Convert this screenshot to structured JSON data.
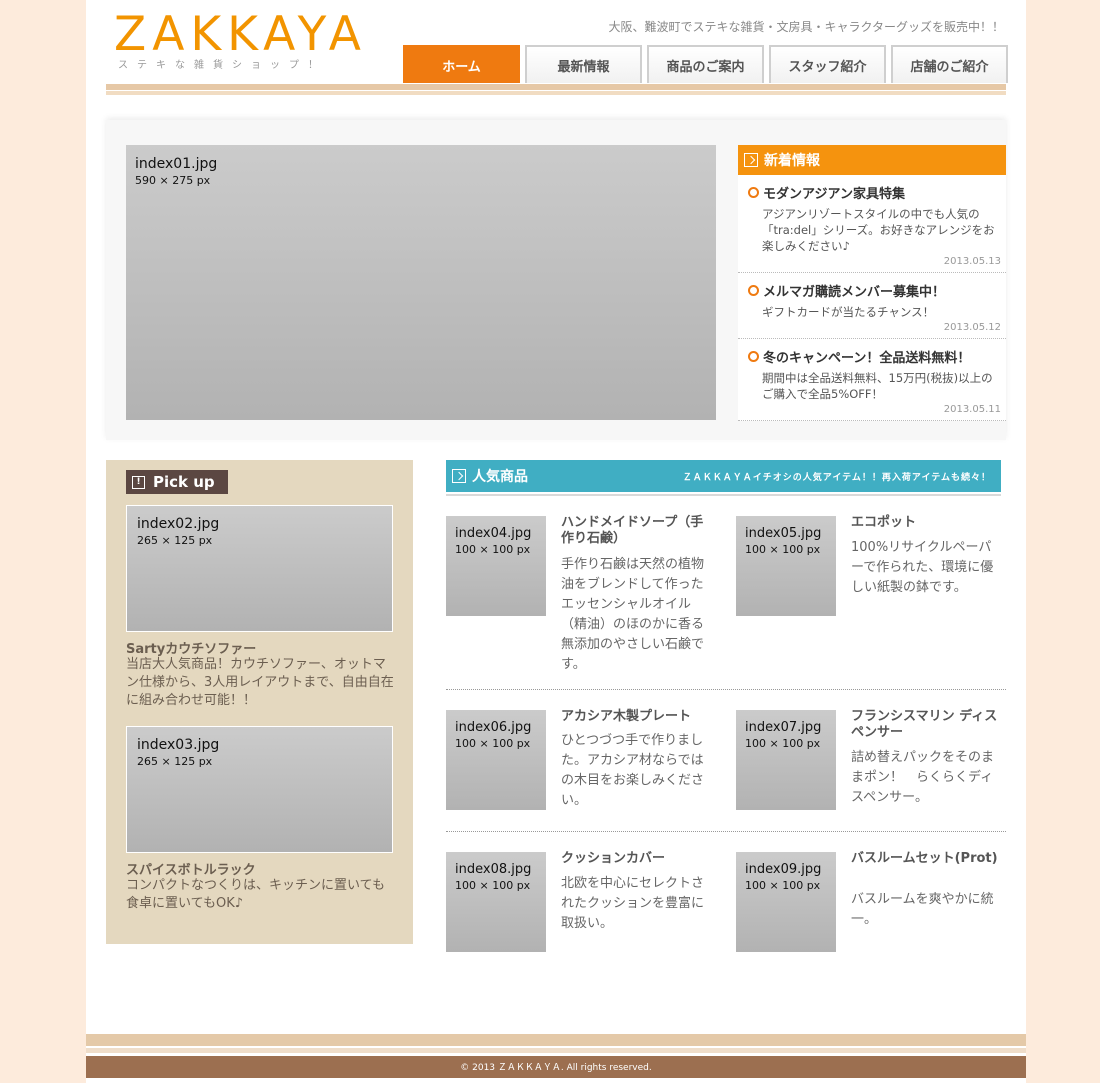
{
  "header": {
    "logo": "ZAKKAYA",
    "logo_sub": "ステキな雑貨ショップ！",
    "tagline": "大阪、難波町でステキな雑貨・文房具・キャラクターグッズを販売中！！",
    "nav": [
      "ホーム",
      "最新情報",
      "商品のご案内",
      "スタッフ紹介",
      "店舗のご紹介"
    ],
    "active_nav": "ホーム"
  },
  "hero": {
    "name": "index01.jpg",
    "size": "590 × 275 px"
  },
  "news": {
    "heading": "新着情報",
    "items": [
      {
        "title": "モダンアジアン家具特集",
        "body": "アジアンリゾートスタイルの中でも人気の「tra:del」シリーズ。お好きなアレンジをお楽しみください♪",
        "date": "2013.05.13"
      },
      {
        "title": "メルマガ購読メンバー募集中！",
        "body": "ギフトカードが当たるチャンス！",
        "date": "2013.05.12"
      },
      {
        "title": "冬のキャンペーン！全品送料無料！",
        "body": "期間中は全品送料無料、15万円(税抜)以上のご購入で全品5%OFF！",
        "date": "2013.05.11"
      }
    ]
  },
  "pickup": {
    "heading": "Pick up",
    "items": [
      {
        "img": "index02.jpg",
        "size": "265 × 125 px",
        "title": "Sartyカウチソファー",
        "desc": "当店大人気商品！カウチソファー、オットマン仕様から、3人用レイアウトまで、自由自在に組み合わせ可能！！"
      },
      {
        "img": "index03.jpg",
        "size": "265 × 125 px",
        "title": "スパイスボトルラック",
        "desc": "コンパクトなつくりは、キッチンに置いても食卓に置いてもOK♪"
      }
    ]
  },
  "popular": {
    "heading": "人気商品",
    "sub": "ＺＡＫＫＡＹＡイチオシの人気アイテム！！再入荷アイテムも続々！",
    "items": [
      {
        "img": "index04.jpg",
        "size": "100 × 100 px",
        "name": "ハンドメイドソープ（手作り石鹸）",
        "desc": "手作り石鹸は天然の植物油をブレンドして作ったエッセンシャルオイル（精油）のほのかに香る無添加のやさしい石鹸です。"
      },
      {
        "img": "index05.jpg",
        "size": "100 × 100 px",
        "name": "エコポット",
        "desc": "100%リサイクルペーパーで作られた、環境に優しい紙製の鉢です。"
      },
      {
        "img": "index06.jpg",
        "size": "100 × 100 px",
        "name": "アカシア木製プレート",
        "desc": "ひとつづつ手で作りました。アカシア材ならではの木目をお楽しみください。"
      },
      {
        "img": "index07.jpg",
        "size": "100 × 100 px",
        "name": "フランシスマリン ディスペンサー",
        "desc": "詰め替えパックをそのままポン！　らくらくディスペンサー。"
      },
      {
        "img": "index08.jpg",
        "size": "100 × 100 px",
        "name": "クッションカバー",
        "desc": "北欧を中心にセレクトされたクッションを豊富に取扱い。"
      },
      {
        "img": "index09.jpg",
        "size": "100 × 100 px",
        "name": "バスルームセット(Prot)",
        "desc": "バスルームを爽やかに統一。"
      }
    ]
  },
  "footer": {
    "copyright": "© 2013 ＺＡＫＫＡＹＡ. All rights reserved."
  }
}
